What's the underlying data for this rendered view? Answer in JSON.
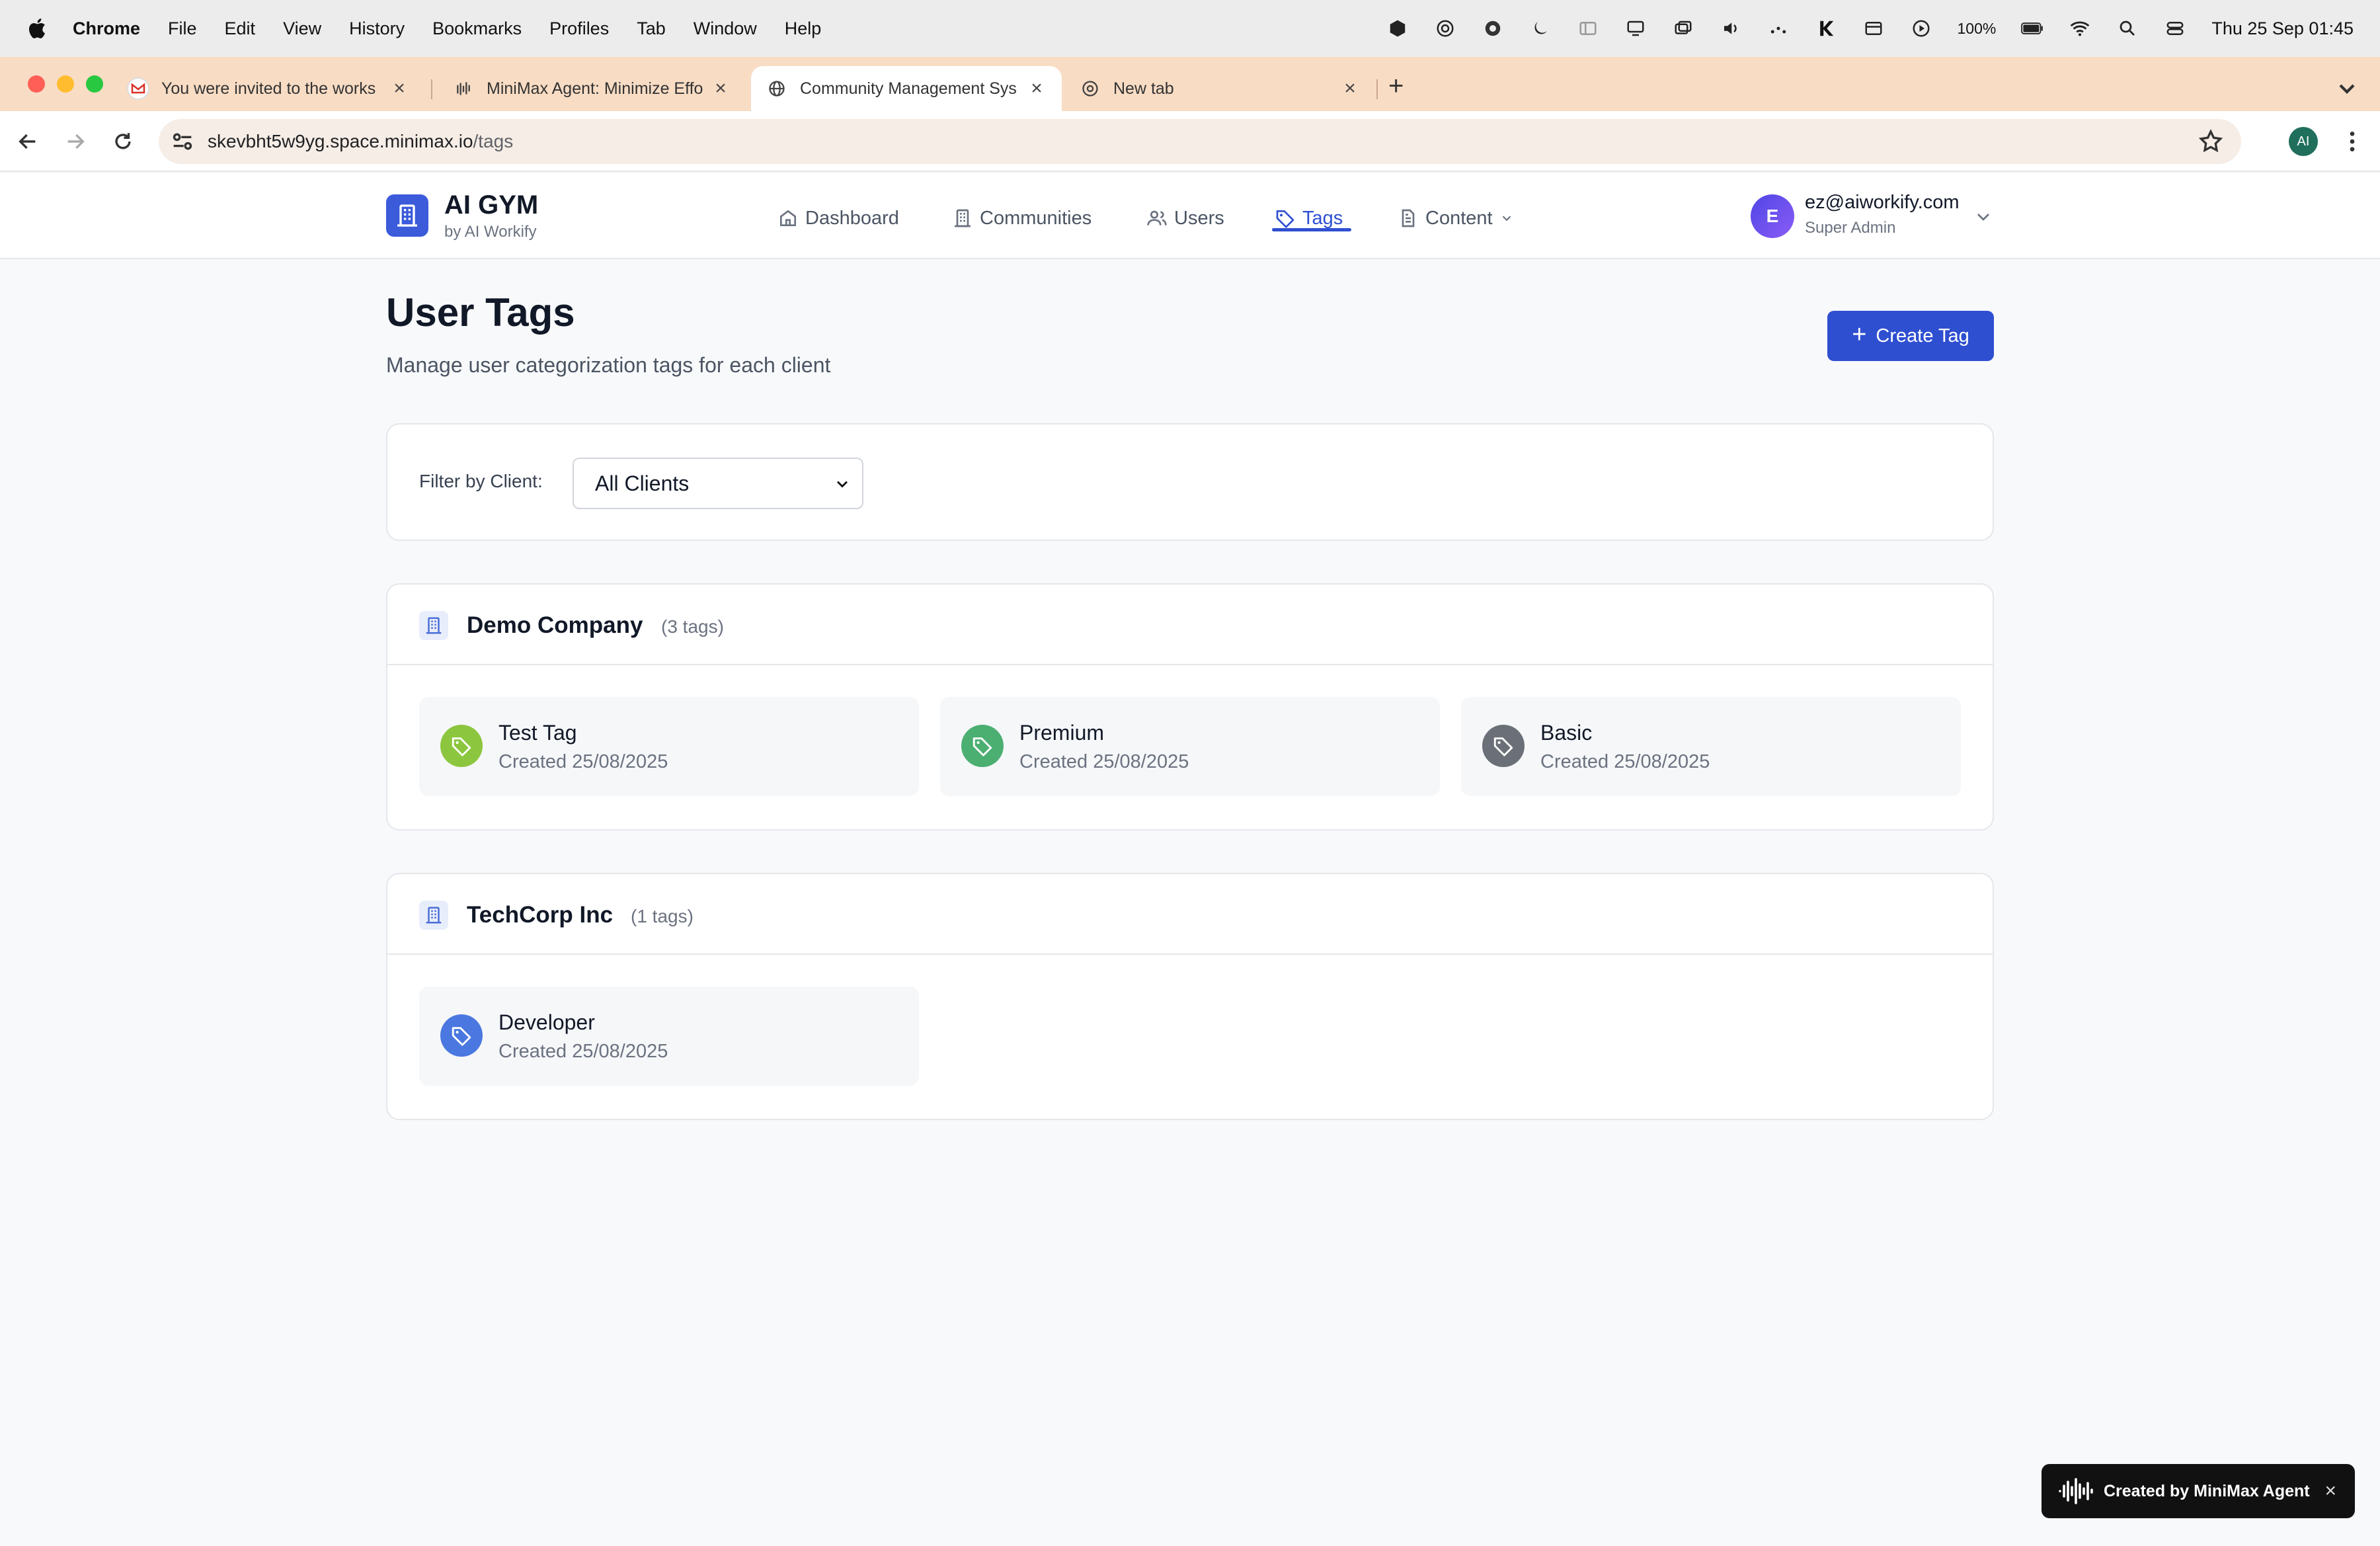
{
  "menubar": {
    "app": "Chrome",
    "items": [
      "File",
      "Edit",
      "View",
      "History",
      "Bookmarks",
      "Profiles",
      "Tab",
      "Window",
      "Help"
    ],
    "battery": "100%",
    "clock": "Thu 25 Sep  01:45"
  },
  "tabs": [
    {
      "title": "You were invited to the works",
      "icon": "gmail-icon",
      "active": false
    },
    {
      "title": "MiniMax Agent: Minimize Effo",
      "icon": "minimax-icon",
      "active": false
    },
    {
      "title": "Community Management Sys",
      "icon": "globe-icon",
      "active": true
    },
    {
      "title": "New tab",
      "icon": "chrome-icon",
      "active": false
    }
  ],
  "address": {
    "host": "skevbht5w9yg.space.minimax.io",
    "path": "/tags",
    "profile_initials": "AI"
  },
  "header": {
    "brand": "AI GYM",
    "brand_sub": "by AI Workify",
    "nav": {
      "dashboard": "Dashboard",
      "communities": "Communities",
      "users": "Users",
      "tags": "Tags",
      "content": "Content"
    },
    "user": {
      "initial": "E",
      "email": "ez@aiworkify.com",
      "role": "Super Admin"
    }
  },
  "page": {
    "title": "User Tags",
    "subtitle": "Manage user categorization tags for each client",
    "create_label": "Create Tag"
  },
  "filter": {
    "label": "Filter by Client:",
    "selected": "All Clients"
  },
  "groups": [
    {
      "name": "Demo Company",
      "count": "(3 tags)",
      "tags": [
        {
          "name": "Test Tag",
          "created": "Created 25/08/2025",
          "color": "#8cc63f"
        },
        {
          "name": "Premium",
          "created": "Created 25/08/2025",
          "color": "#4caf72"
        },
        {
          "name": "Basic",
          "created": "Created 25/08/2025",
          "color": "#6b6f78"
        }
      ]
    },
    {
      "name": "TechCorp Inc",
      "count": "(1 tags)",
      "tags": [
        {
          "name": "Developer",
          "created": "Created 25/08/2025",
          "color": "#4a78e0"
        }
      ]
    }
  ],
  "toast": {
    "text": "Created by MiniMax Agent",
    "close": "×"
  },
  "colors": {
    "accent": "#2f4fd1",
    "tabbar": "#f8dcc4"
  }
}
